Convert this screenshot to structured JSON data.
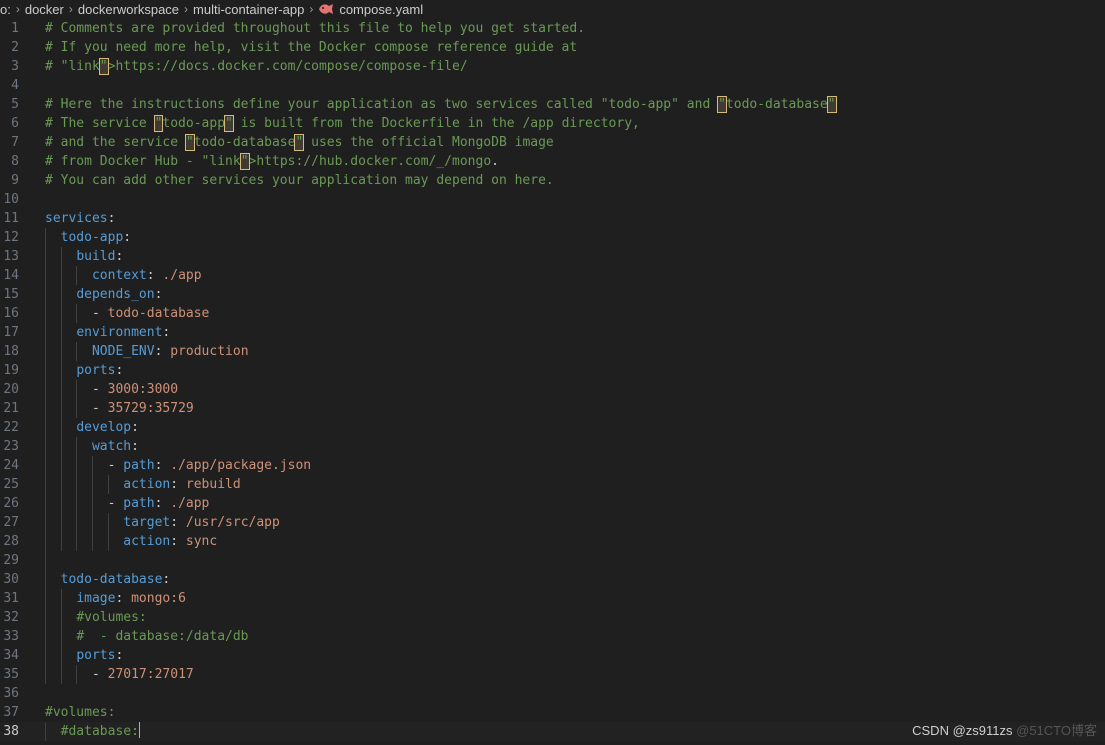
{
  "breadcrumb": {
    "items": [
      "o:",
      "docker",
      "dockerworkspace",
      "multi-container-app"
    ],
    "file_icon": "yaml-file-icon",
    "file": "compose.yaml",
    "icon_color": "#e37373"
  },
  "editor": {
    "current_line": 38,
    "lines": [
      {
        "n": "1",
        "t": "# Comments are provided throughout this file to help you get started."
      },
      {
        "n": "2",
        "t": "# If you need more help, visit the Docker compose reference guide at"
      },
      {
        "n": "3",
        "t": "# https://docs.docker.com/compose/compose-file/"
      },
      {
        "n": "4",
        "t": ""
      },
      {
        "n": "5",
        "t": "# Here the instructions define your application as two services called \"todo-app\" and \"todo-database\""
      },
      {
        "n": "6",
        "t": "# The service \"todo-app\" is built from the Dockerfile in the /app directory,"
      },
      {
        "n": "7",
        "t": "# and the service \"todo-database\" uses the official MongoDB image"
      },
      {
        "n": "8",
        "t": "# from Docker Hub - https://hub.docker.com/_/mongo."
      },
      {
        "n": "9",
        "t": "# You can add other services your application may depend on here."
      },
      {
        "n": "10",
        "t": ""
      },
      {
        "n": "11",
        "t": "services:"
      },
      {
        "n": "12",
        "t": "  todo-app:"
      },
      {
        "n": "13",
        "t": "    build:"
      },
      {
        "n": "14",
        "t": "      context: ./app"
      },
      {
        "n": "15",
        "t": "    depends_on:"
      },
      {
        "n": "16",
        "t": "      - todo-database"
      },
      {
        "n": "17",
        "t": "    environment:"
      },
      {
        "n": "18",
        "t": "      NODE_ENV: production"
      },
      {
        "n": "19",
        "t": "    ports:"
      },
      {
        "n": "20",
        "t": "      - 3000:3000"
      },
      {
        "n": "21",
        "t": "      - 35729:35729"
      },
      {
        "n": "22",
        "t": "    develop:"
      },
      {
        "n": "23",
        "t": "      watch:"
      },
      {
        "n": "24",
        "t": "        - path: ./app/package.json"
      },
      {
        "n": "25",
        "t": "          action: rebuild"
      },
      {
        "n": "26",
        "t": "        - path: ./app"
      },
      {
        "n": "27",
        "t": "          target: /usr/src/app"
      },
      {
        "n": "28",
        "t": "          action: sync"
      },
      {
        "n": "29",
        "t": ""
      },
      {
        "n": "30",
        "t": "  todo-database:"
      },
      {
        "n": "31",
        "t": "    image: mongo:6"
      },
      {
        "n": "32",
        "t": "    #volumes:"
      },
      {
        "n": "33",
        "t": "    #  - database:/data/db"
      },
      {
        "n": "34",
        "t": "    ports:"
      },
      {
        "n": "35",
        "t": "      - 27017:27017"
      },
      {
        "n": "36",
        "t": ""
      },
      {
        "n": "37",
        "t": "#volumes:"
      },
      {
        "n": "38",
        "t": "  #database:"
      }
    ]
  },
  "colors": {
    "background": "#1f1f1f",
    "comment": "#6a9955",
    "key": "#569cd6",
    "value": "#ce9178",
    "line_number": "#6e7681"
  },
  "watermark": {
    "main": "CSDN @zs911zs",
    "ghost": "@51CTO博客"
  }
}
